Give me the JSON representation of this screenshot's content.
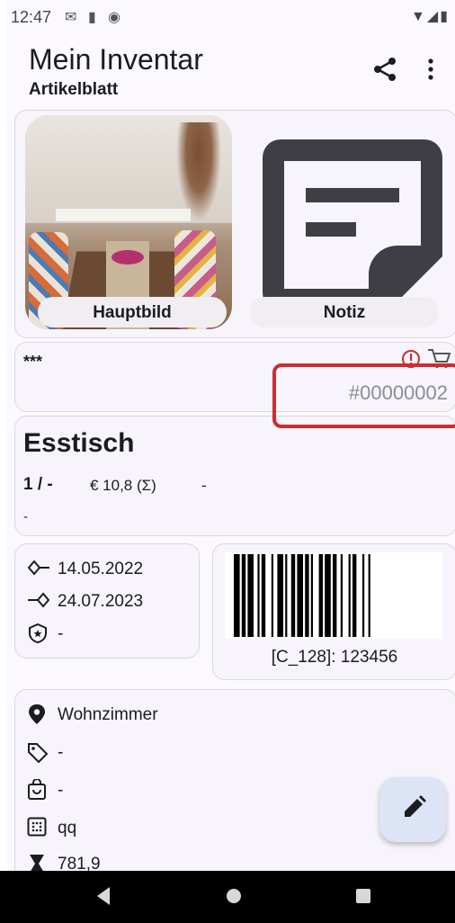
{
  "status": {
    "time": "12:47"
  },
  "appbar": {
    "title": "Mein Inventar",
    "subtitle": "Artikelblatt"
  },
  "images": {
    "main_label": "Hauptbild",
    "note_label": "Notiz"
  },
  "identity": {
    "stars": "***",
    "item_id": "#00000002"
  },
  "item": {
    "name": "Esstisch",
    "quantity": "1 / -",
    "price": "€ 10,8 (Σ)",
    "price_extra": "-",
    "description": "-"
  },
  "dates": {
    "acquired": "14.05.2022",
    "expires": "24.07.2023",
    "warranty": "-"
  },
  "barcode": {
    "text": "[C_128]: 123456",
    "bars": [
      3,
      1,
      2,
      1,
      3,
      2,
      1,
      1,
      2,
      3,
      1,
      2,
      3,
      1,
      1,
      2,
      2,
      1,
      3,
      1,
      2,
      1,
      1,
      3,
      2,
      1,
      3,
      1,
      2,
      2,
      1,
      3,
      1,
      1,
      2,
      3,
      1,
      2,
      1,
      3
    ]
  },
  "details": {
    "location": "Wohnzimmer",
    "tag": "-",
    "store": "-",
    "category": "qq",
    "weight": "781,9"
  },
  "colors": {
    "accent_red": "#cc2d2d",
    "fab_bg": "#dde4f5"
  }
}
